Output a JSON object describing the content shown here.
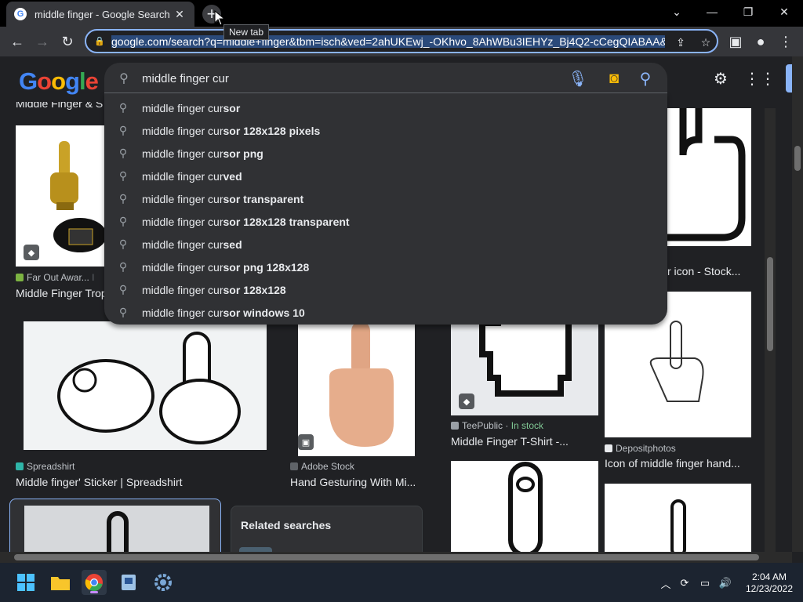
{
  "browser": {
    "tab_title": "middle finger - Google Search",
    "tab_favicon": "G",
    "new_tab_tooltip": "New tab",
    "url": "google.com/search?q=middle+finger&tbm=isch&ved=2ahUKEwj_-OKhvo_8AhWBu3IEHYz_Bj4Q2-cCegQIABAA&o"
  },
  "search": {
    "query": "middle finger cur",
    "typed_prefix": "middle finger cur"
  },
  "suggestions": [
    {
      "rest": "sor"
    },
    {
      "rest": "sor 128x128 pixels"
    },
    {
      "rest": "sor png"
    },
    {
      "rest": "ved"
    },
    {
      "rest": "sor transparent"
    },
    {
      "rest": "sor 128x128 transparent"
    },
    {
      "rest": "sed"
    },
    {
      "rest": "sor png 128x128"
    },
    {
      "rest": "sor 128x128"
    },
    {
      "rest": "sor windows 10"
    }
  ],
  "results": {
    "row0_left_title": "Middle Finger & S",
    "trophy_source": "Far Out Awar...",
    "trophy_source_extra": "I",
    "trophy_title": "Middle Finger Trop",
    "stock_icon_title": "r icon - Stock...",
    "sticker_source": "Spreadshirt",
    "sticker_title": "Middle finger' Sticker | Spreadshirt",
    "hand_source": "Adobe Stock",
    "hand_title": "Hand Gesturing With Mi...",
    "tee_source": "TeePublic",
    "tee_stock": "In stock",
    "tee_title": "Middle Finger T-Shirt -...",
    "deposit_source": "Depositphotos",
    "deposit_title": "Icon of middle finger hand...",
    "related_title": "Related searches"
  },
  "taskbar": {
    "time": "2:04 AM",
    "date": "12/23/2022"
  },
  "colors": {
    "accent": "#8ab4f8",
    "in_stock": "#81c995"
  }
}
